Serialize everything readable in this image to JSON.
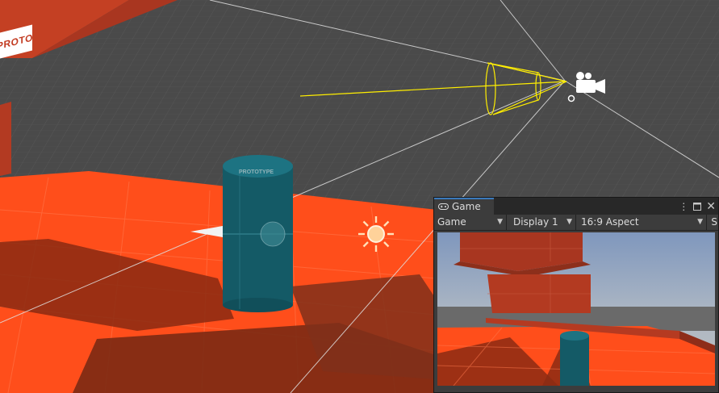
{
  "scene": {
    "prototype_label": "PROTO",
    "cylinder_label": "PROTOTYPE"
  },
  "game_window": {
    "tab_label": "Game",
    "tab_icon": "gamepad-icon",
    "menu_icon": "kebab-menu-icon",
    "maximize_icon": "maximize-icon",
    "close_icon": "close-icon",
    "toolbar": {
      "view_mode": "Game",
      "display": "Display 1",
      "aspect": "16:9 Aspect",
      "trailing": "S"
    }
  },
  "colors": {
    "floor": "#ff4f1d",
    "box": "#b53a21",
    "cylinder": "#145a66",
    "grid": "#5a5a5a",
    "camera_gizmo": "#ffee00",
    "tab_accent": "#3a79bb"
  }
}
